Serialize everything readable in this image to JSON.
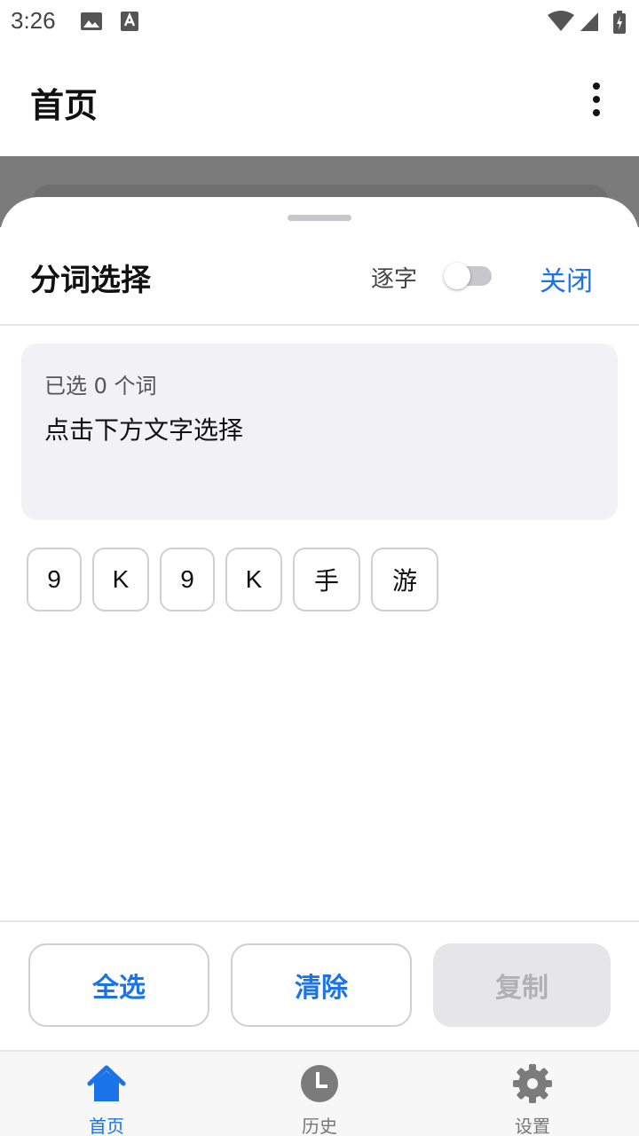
{
  "status_bar": {
    "time": "3:26"
  },
  "app_bar": {
    "title": "首页"
  },
  "sheet": {
    "title": "分词选择",
    "char_mode_label": "逐字",
    "char_mode_on": false,
    "close_label": "关闭",
    "selected_count": "已选 0 个词",
    "hint": "点击下方文字选择",
    "tokens": [
      "9",
      "K",
      "9",
      "K",
      "手",
      "游"
    ],
    "select_all_label": "全选",
    "clear_label": "清除",
    "copy_label": "复制"
  },
  "bottom_nav": {
    "items": [
      {
        "label": "首页",
        "icon": "home-icon",
        "active": true
      },
      {
        "label": "历史",
        "icon": "history-clock-icon",
        "active": false
      },
      {
        "label": "设置",
        "icon": "gear-icon",
        "active": false
      }
    ]
  },
  "colors": {
    "accent": "#1a73e8",
    "scrim": "#7b7b7b",
    "panel": "#f1f1f6"
  }
}
